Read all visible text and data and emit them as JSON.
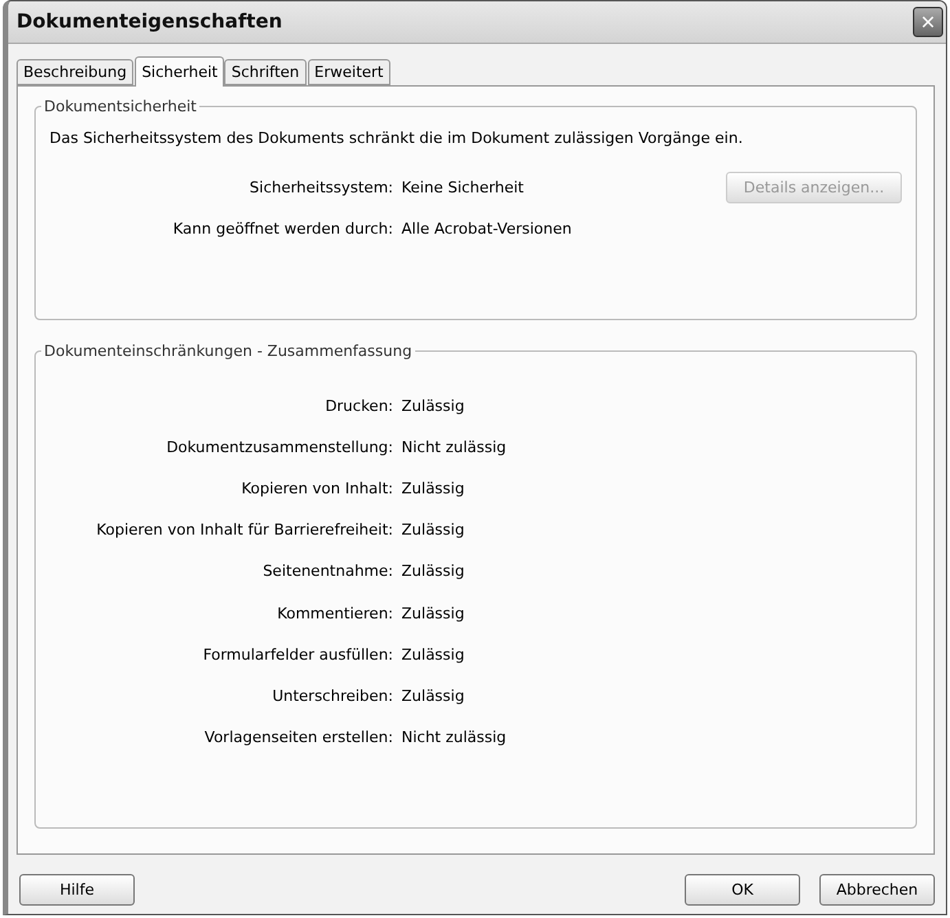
{
  "window": {
    "title": "Dokumenteigenschaften",
    "close": "×"
  },
  "tabs": [
    {
      "label": "Beschreibung",
      "selected": false
    },
    {
      "label": "Sicherheit",
      "selected": true
    },
    {
      "label": "Schriften",
      "selected": false
    },
    {
      "label": "Erweitert",
      "selected": false
    }
  ],
  "security": {
    "legend": "Dokumentsicherheit",
    "intro": "Das Sicherheitssystem des Dokuments schränkt die im Dokument zulässigen Vorgänge ein.",
    "rows": [
      {
        "label": "Sicherheitssystem:",
        "value": "Keine Sicherheit"
      },
      {
        "label": "Kann geöffnet werden durch:",
        "value": "Alle Acrobat-Versionen"
      }
    ],
    "details_button": {
      "label": "Details anzeigen...",
      "disabled": true
    }
  },
  "restrictions": {
    "legend": "Dokumenteinschränkungen - Zusammenfassung",
    "rows": [
      {
        "label": "Drucken:",
        "value": "Zulässig"
      },
      {
        "label": "Dokumentzusammenstellung:",
        "value": "Nicht zulässig"
      },
      {
        "label": "Kopieren von Inhalt:",
        "value": "Zulässig"
      },
      {
        "label": "Kopieren von Inhalt für Barrierefreiheit:",
        "value": "Zulässig"
      },
      {
        "label": "Seitenentnahme:",
        "value": "Zulässig"
      },
      {
        "label": "Kommentieren:",
        "value": "Zulässig"
      },
      {
        "label": "Formularfelder ausfüllen:",
        "value": "Zulässig"
      },
      {
        "label": "Unterschreiben:",
        "value": "Zulässig"
      },
      {
        "label": "Vorlagenseiten erstellen:",
        "value": "Nicht zulässig"
      }
    ]
  },
  "buttons": {
    "left": [
      "Hilfe"
    ],
    "right": [
      "OK",
      "Abbrechen"
    ]
  }
}
